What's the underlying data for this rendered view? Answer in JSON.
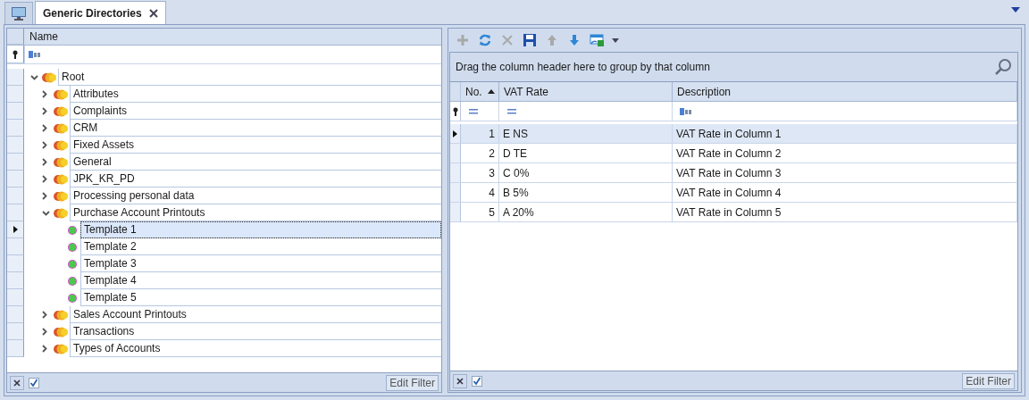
{
  "tab": {
    "title": "Generic Directories",
    "selected": true
  },
  "tree": {
    "column": "Name",
    "nodes": [
      {
        "label": "Root",
        "kind": "folder",
        "expanded": true,
        "selected": false,
        "children": [
          {
            "label": "Attributes",
            "kind": "folder",
            "expanded": false,
            "selected": false
          },
          {
            "label": "Complaints",
            "kind": "folder",
            "expanded": false,
            "selected": false
          },
          {
            "label": "CRM",
            "kind": "folder",
            "expanded": false,
            "selected": false
          },
          {
            "label": "Fixed Assets",
            "kind": "folder",
            "expanded": false,
            "selected": false
          },
          {
            "label": "General",
            "kind": "folder",
            "expanded": false,
            "selected": false
          },
          {
            "label": "JPK_KR_PD",
            "kind": "folder",
            "expanded": false,
            "selected": false
          },
          {
            "label": "Processing personal data",
            "kind": "folder",
            "expanded": false,
            "selected": false
          },
          {
            "label": "Purchase Account Printouts",
            "kind": "folder",
            "expanded": true,
            "selected": false,
            "children": [
              {
                "label": "Template 1",
                "kind": "item",
                "selected": true
              },
              {
                "label": "Template 2",
                "kind": "item",
                "selected": false
              },
              {
                "label": "Template 3",
                "kind": "item",
                "selected": false
              },
              {
                "label": "Template 4",
                "kind": "item",
                "selected": false
              },
              {
                "label": "Template 5",
                "kind": "item",
                "selected": false
              }
            ]
          },
          {
            "label": "Sales Account Printouts",
            "kind": "folder",
            "expanded": false,
            "selected": false
          },
          {
            "label": "Transactions",
            "kind": "folder",
            "expanded": false,
            "selected": false
          },
          {
            "label": "Types of Accounts",
            "kind": "folder",
            "expanded": false,
            "selected": false
          }
        ]
      }
    ]
  },
  "left_footer": {
    "filter_enabled": true,
    "button": "Edit Filter"
  },
  "toolbar": [
    {
      "kind": "add",
      "disabled": true
    },
    {
      "kind": "refresh",
      "disabled": false
    },
    {
      "kind": "delete",
      "disabled": true
    },
    {
      "kind": "save",
      "disabled": false
    },
    {
      "kind": "up",
      "disabled": true
    },
    {
      "kind": "down",
      "disabled": false
    },
    {
      "kind": "export",
      "disabled": false
    }
  ],
  "grid": {
    "group_panel": "Drag the column header here to group by that column",
    "columns": [
      {
        "label": "No.",
        "sorted": true
      },
      {
        "label": "VAT Rate",
        "sorted": false
      },
      {
        "label": "Description",
        "sorted": false
      }
    ],
    "filter_row": [
      {
        "kind": "equals"
      },
      {
        "kind": "equals"
      },
      {
        "kind": "text"
      }
    ],
    "rows": [
      {
        "cells": [
          "1",
          "E NS",
          "VAT Rate in Column 1"
        ],
        "selected": true
      },
      {
        "cells": [
          "2",
          "D TE",
          "VAT Rate in Column 2"
        ],
        "selected": false
      },
      {
        "cells": [
          "3",
          "C 0%",
          "VAT Rate in Column 3"
        ],
        "selected": false
      },
      {
        "cells": [
          "4",
          "B 5%",
          "VAT Rate in Column 4"
        ],
        "selected": false
      },
      {
        "cells": [
          "5",
          "A 20%",
          "VAT Rate in Column 5"
        ],
        "selected": false
      }
    ]
  },
  "right_footer": {
    "filter_enabled": true,
    "button": "Edit Filter"
  }
}
